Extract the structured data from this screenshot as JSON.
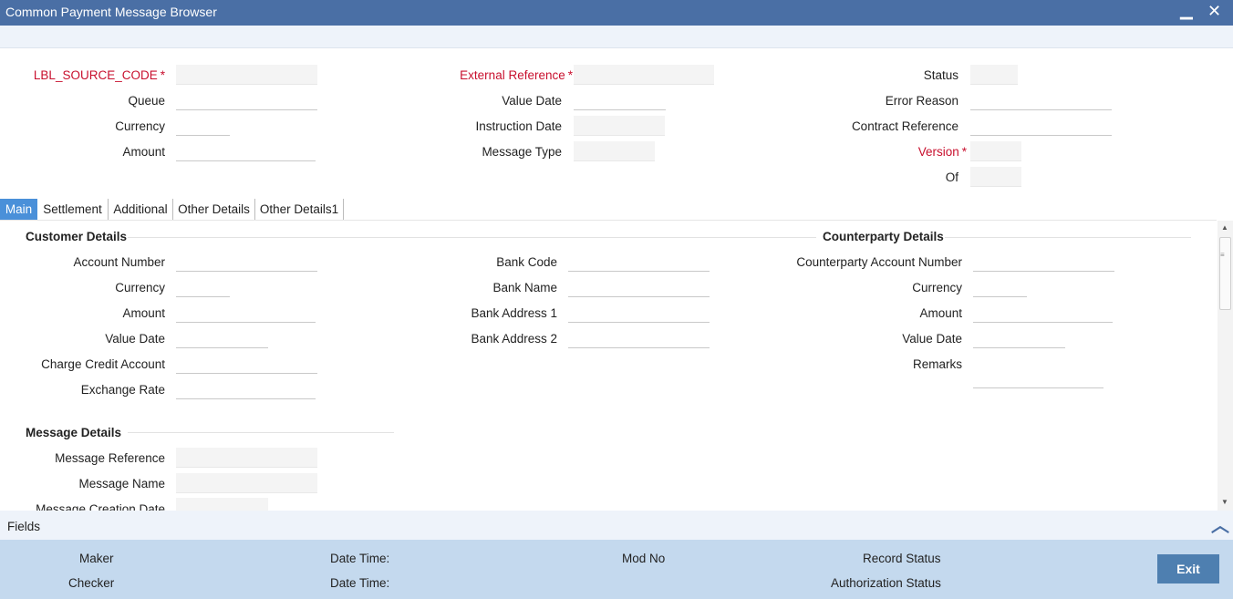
{
  "window": {
    "title": "Common Payment Message Browser",
    "minimize_glyph": "▁",
    "close_glyph": "✕"
  },
  "header": {
    "source_code_label": "LBL_SOURCE_CODE",
    "queue_label": "Queue",
    "currency_label": "Currency",
    "amount_label": "Amount",
    "external_reference_label": "External Reference",
    "value_date_label": "Value Date",
    "instruction_date_label": "Instruction Date",
    "message_type_label": "Message Type",
    "status_label": "Status",
    "error_reason_label": "Error Reason",
    "contract_reference_label": "Contract Reference",
    "version_label": "Version",
    "of_label": "Of",
    "required_marker": "*"
  },
  "tabs": [
    "Main",
    "Settlement",
    "Additional",
    "Other Details",
    "Other Details1"
  ],
  "customer_details": {
    "title": "Customer Details",
    "account_number": "Account Number",
    "currency": "Currency",
    "amount": "Amount",
    "value_date": "Value Date",
    "charge_credit_account": "Charge Credit Account",
    "exchange_rate": "Exchange Rate"
  },
  "bank_details": {
    "bank_code": "Bank Code",
    "bank_name": "Bank Name",
    "bank_address_1": "Bank Address 1",
    "bank_address_2": "Bank Address 2"
  },
  "counterparty_details": {
    "title": "Counterparty Details",
    "account_number": "Counterparty Account Number",
    "currency": "Currency",
    "amount": "Amount",
    "value_date": "Value Date",
    "remarks": "Remarks"
  },
  "message_details": {
    "title": "Message Details",
    "message_reference": "Message Reference",
    "message_name": "Message Name",
    "message_creation_date": "Message Creation Date"
  },
  "fields_bar": {
    "label": "Fields",
    "collapse_glyph": "︿"
  },
  "footer": {
    "maker": "Maker",
    "checker": "Checker",
    "date_time_1": "Date Time:",
    "date_time_2": "Date Time:",
    "mod_no": "Mod No",
    "record_status": "Record Status",
    "authorization_status": "Authorization Status",
    "exit_label": "Exit"
  },
  "colors": {
    "titlebar": "#4a6fa5",
    "required": "#c8102e",
    "active_tab": "#4a90d9",
    "footer": "#c4d9ee",
    "exit_button": "#4e7fb0"
  }
}
